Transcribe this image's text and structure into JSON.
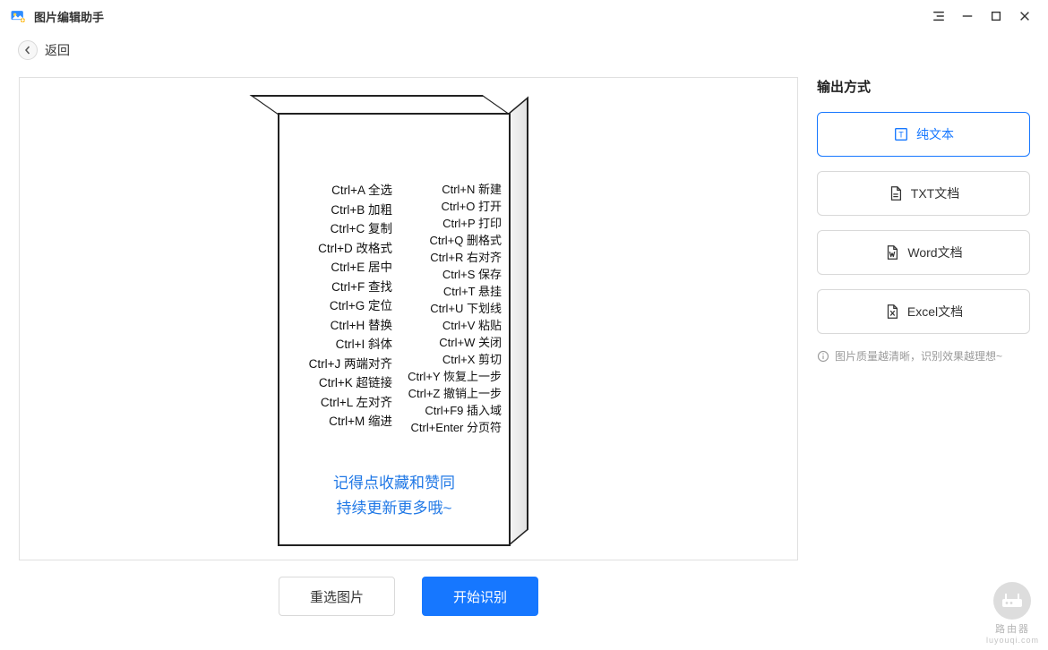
{
  "app": {
    "title": "图片编辑助手"
  },
  "toolbar": {
    "back_label": "返回"
  },
  "actions": {
    "reselect": "重选图片",
    "start": "开始识别"
  },
  "side": {
    "title": "输出方式",
    "options": [
      {
        "label": "纯文本",
        "active": true
      },
      {
        "label": "TXT文档",
        "active": false
      },
      {
        "label": "Word文档",
        "active": false
      },
      {
        "label": "Excel文档",
        "active": false
      }
    ],
    "hint": "图片质量越清晰，识别效果越理想~"
  },
  "preview": {
    "left_col": [
      "Ctrl+A 全选",
      "Ctrl+B 加粗",
      "Ctrl+C 复制",
      "Ctrl+D 改格式",
      "Ctrl+E 居中",
      "Ctrl+F 查找",
      "Ctrl+G 定位",
      "Ctrl+H 替换",
      "Ctrl+I 斜体",
      "Ctrl+J 两端对齐",
      "Ctrl+K 超链接",
      "Ctrl+L 左对齐",
      "Ctrl+M 缩进"
    ],
    "right_col": [
      "Ctrl+N 新建",
      "Ctrl+O 打开",
      "Ctrl+P 打印",
      "Ctrl+Q 删格式",
      "Ctrl+R 右对齐",
      "Ctrl+S 保存",
      "Ctrl+T 悬挂",
      "Ctrl+U 下划线",
      "Ctrl+V 粘贴",
      "Ctrl+W 关闭",
      "Ctrl+X 剪切",
      "Ctrl+Y 恢复上一步",
      "Ctrl+Z 撤销上一步",
      "Ctrl+F9 插入域",
      "Ctrl+Enter 分页符"
    ],
    "footer_line1": "记得点收藏和赞同",
    "footer_line2": "持续更新更多哦~"
  },
  "watermark": {
    "text": "路由器",
    "sub": "luyouqi.com"
  }
}
